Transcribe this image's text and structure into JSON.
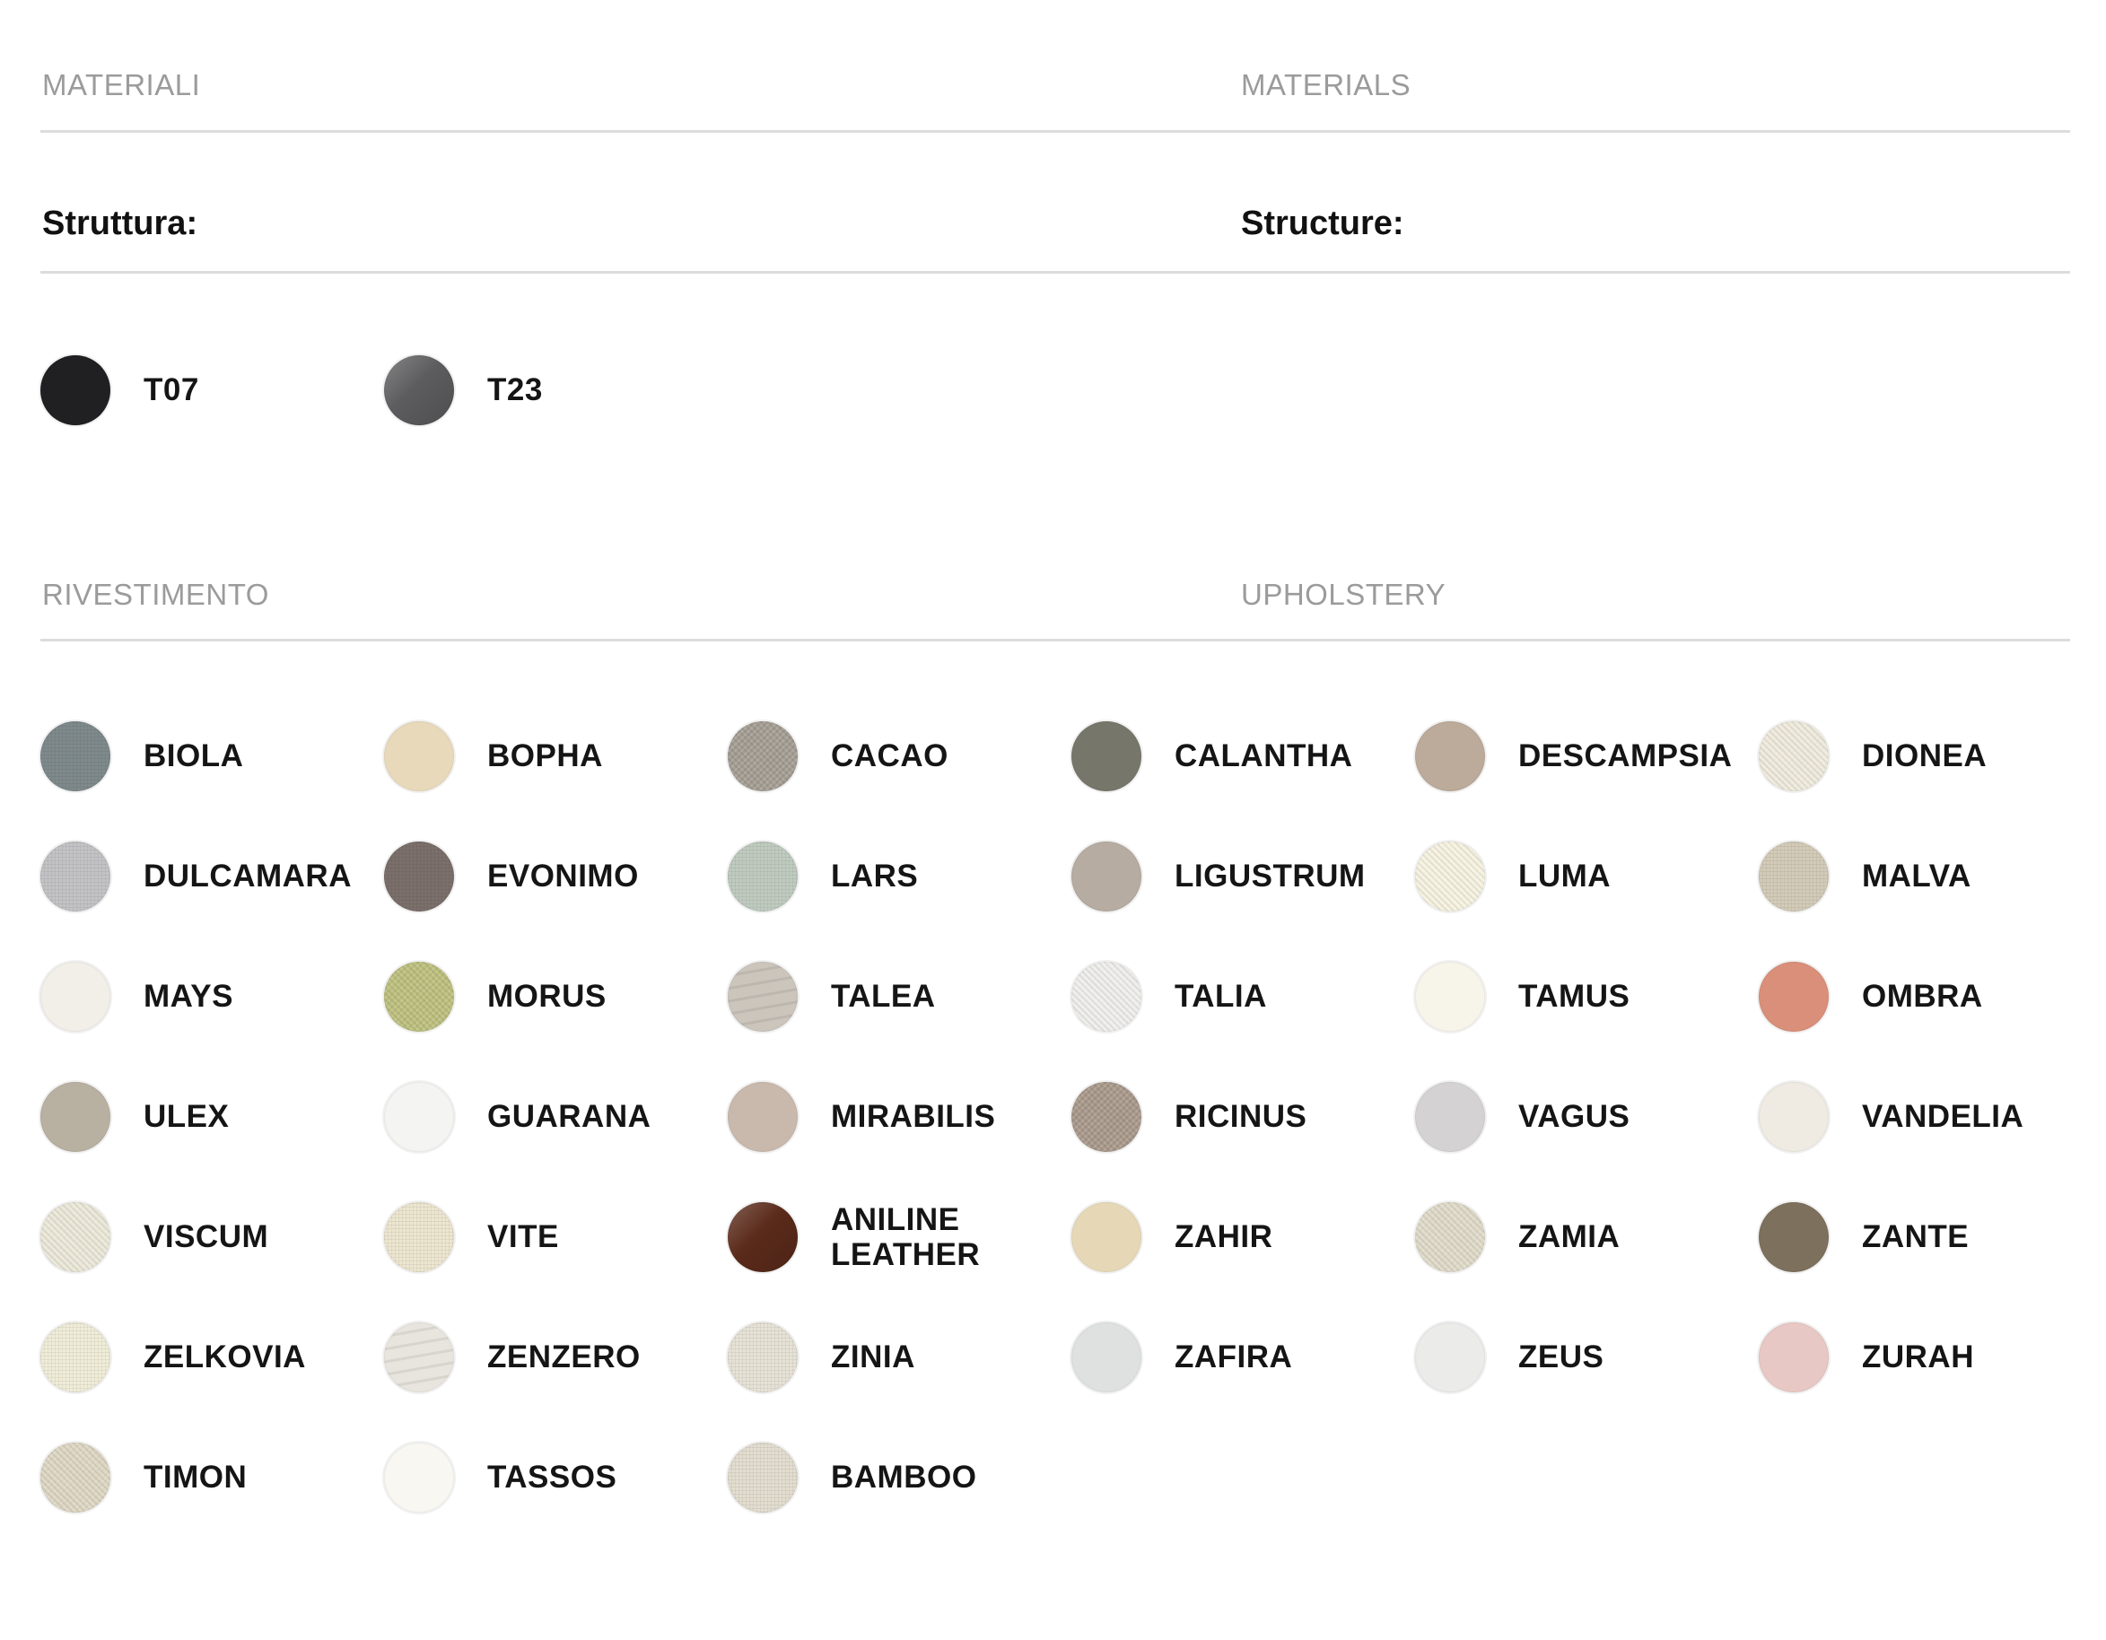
{
  "materials": {
    "label_it": "MATERIALI",
    "label_en": "MATERIALS"
  },
  "structure": {
    "label_it": "Struttura:",
    "label_en": "Structure:",
    "items": [
      {
        "name": "T07",
        "color": "#202022",
        "texture": "none"
      },
      {
        "name": "T23",
        "color": "#5c5c5e",
        "texture": "shine"
      }
    ]
  },
  "upholstery": {
    "label_it": "RIVESTIMENTO",
    "label_en": "UPHOLSTERY",
    "items": [
      {
        "name": "BIOLA",
        "color": "#7f8a8c",
        "texture": "weave"
      },
      {
        "name": "BOPHA",
        "color": "#e8d9bb",
        "texture": "none"
      },
      {
        "name": "CACAO",
        "color": "#a39c92",
        "texture": "grain"
      },
      {
        "name": "CALANTHA",
        "color": "#76766a",
        "texture": "none"
      },
      {
        "name": "DESCAMPSIA",
        "color": "#bcaa9a",
        "texture": "none"
      },
      {
        "name": "DIONEA",
        "color": "#efeadc",
        "texture": "grain"
      },
      {
        "name": "DULCAMARA",
        "color": "#c3c3c6",
        "texture": "weave"
      },
      {
        "name": "EVONIMO",
        "color": "#7b706b",
        "texture": "weave"
      },
      {
        "name": "LARS",
        "color": "#c0cbc0",
        "texture": "weave"
      },
      {
        "name": "LIGUSTRUM",
        "color": "#b6aca1",
        "texture": "none"
      },
      {
        "name": "LUMA",
        "color": "#f6f2e0",
        "texture": "grain"
      },
      {
        "name": "MALVA",
        "color": "#d3cbb8",
        "texture": "weave"
      },
      {
        "name": "MAYS",
        "color": "#f1efe8",
        "texture": "none"
      },
      {
        "name": "MORUS",
        "color": "#bcbf7c",
        "texture": "grain"
      },
      {
        "name": "TALEA",
        "color": "#cbc5bc",
        "texture": "wave"
      },
      {
        "name": "TALIA",
        "color": "#efeeec",
        "texture": "grain"
      },
      {
        "name": "TAMUS",
        "color": "#f7f5ea",
        "texture": "none"
      },
      {
        "name": "OMBRA",
        "color": "#d98f79",
        "texture": "none"
      },
      {
        "name": "ULEX",
        "color": "#b8b0a1",
        "texture": "none"
      },
      {
        "name": "GUARANA",
        "color": "#f4f4f2",
        "texture": "none"
      },
      {
        "name": "MIRABILIS",
        "color": "#c9b9ac",
        "texture": "none"
      },
      {
        "name": "RICINUS",
        "color": "#a8988a",
        "texture": "grain"
      },
      {
        "name": "VAGUS",
        "color": "#d4d2d2",
        "texture": "none"
      },
      {
        "name": "VANDELIA",
        "color": "#efebe2",
        "texture": "none"
      },
      {
        "name": "VISCUM",
        "color": "#ebe8d8",
        "texture": "grain"
      },
      {
        "name": "VITE",
        "color": "#ece6d0",
        "texture": "weave"
      },
      {
        "name": "ANILINE LEATHER",
        "color": "#5a2a1a",
        "texture": "shine"
      },
      {
        "name": "ZAHIR",
        "color": "#e6d8b6",
        "texture": "none"
      },
      {
        "name": "ZAMIA",
        "color": "#dfdac8",
        "texture": "grain"
      },
      {
        "name": "ZANTE",
        "color": "#7d705c",
        "texture": "none"
      },
      {
        "name": "ZELKOVIA",
        "color": "#efecd8",
        "texture": "weave"
      },
      {
        "name": "ZENZERO",
        "color": "#e8e5de",
        "texture": "wave"
      },
      {
        "name": "ZINIA",
        "color": "#e7e2d6",
        "texture": "weave"
      },
      {
        "name": "ZAFIRA",
        "color": "#dfe1e1",
        "texture": "none"
      },
      {
        "name": "ZEUS",
        "color": "#ebebea",
        "texture": "none"
      },
      {
        "name": "ZURAH",
        "color": "#e8c8c4",
        "texture": "none"
      },
      {
        "name": "TIMON",
        "color": "#ddd6c2",
        "texture": "grain"
      },
      {
        "name": "TASSOS",
        "color": "#f8f7f2",
        "texture": "none"
      },
      {
        "name": "BAMBOO",
        "color": "#e2ddcf",
        "texture": "weave"
      }
    ]
  }
}
